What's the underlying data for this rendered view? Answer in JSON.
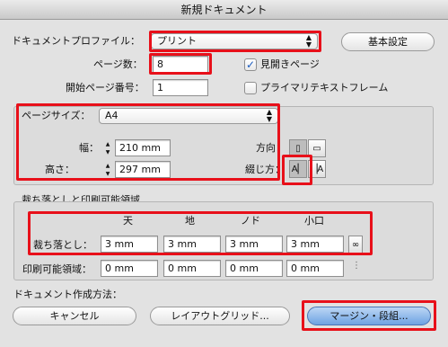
{
  "window": {
    "title": "新規ドキュメント"
  },
  "profile": {
    "label": "ドキュメントプロファイル：",
    "value": "プリント"
  },
  "basic_settings": {
    "label": "基本設定"
  },
  "pages": {
    "label": "ページ数：",
    "value": "8"
  },
  "facing_pages": {
    "label": "見開きページ",
    "checked": true
  },
  "start_page": {
    "label": "開始ページ番号：",
    "value": "1"
  },
  "primary_text_frame": {
    "label": "プライマリテキストフレーム",
    "checked": false
  },
  "page_size": {
    "label": "ページサイズ：",
    "value": "A4",
    "width_label": "幅：",
    "width_value": "210 mm",
    "height_label": "高さ：",
    "height_value": "297 mm",
    "orientation_label": "方向：",
    "binding_label": "綴じ方："
  },
  "bleed_slug": {
    "title": "裁ち落としと印刷可能領域",
    "col_top": "天",
    "col_bottom": "地",
    "col_inside": "ノド",
    "col_outside": "小口",
    "bleed_label": "裁ち落とし：",
    "bleed": [
      "3 mm",
      "3 mm",
      "3 mm",
      "3 mm"
    ],
    "slug_label": "印刷可能領域：",
    "slug": [
      "0 mm",
      "0 mm",
      "0 mm",
      "0 mm"
    ]
  },
  "create_method": {
    "label": "ドキュメント作成方法："
  },
  "buttons": {
    "cancel": "キャンセル",
    "layout_grid": "レイアウトグリッド...",
    "margins_columns": "マージン・段組..."
  }
}
